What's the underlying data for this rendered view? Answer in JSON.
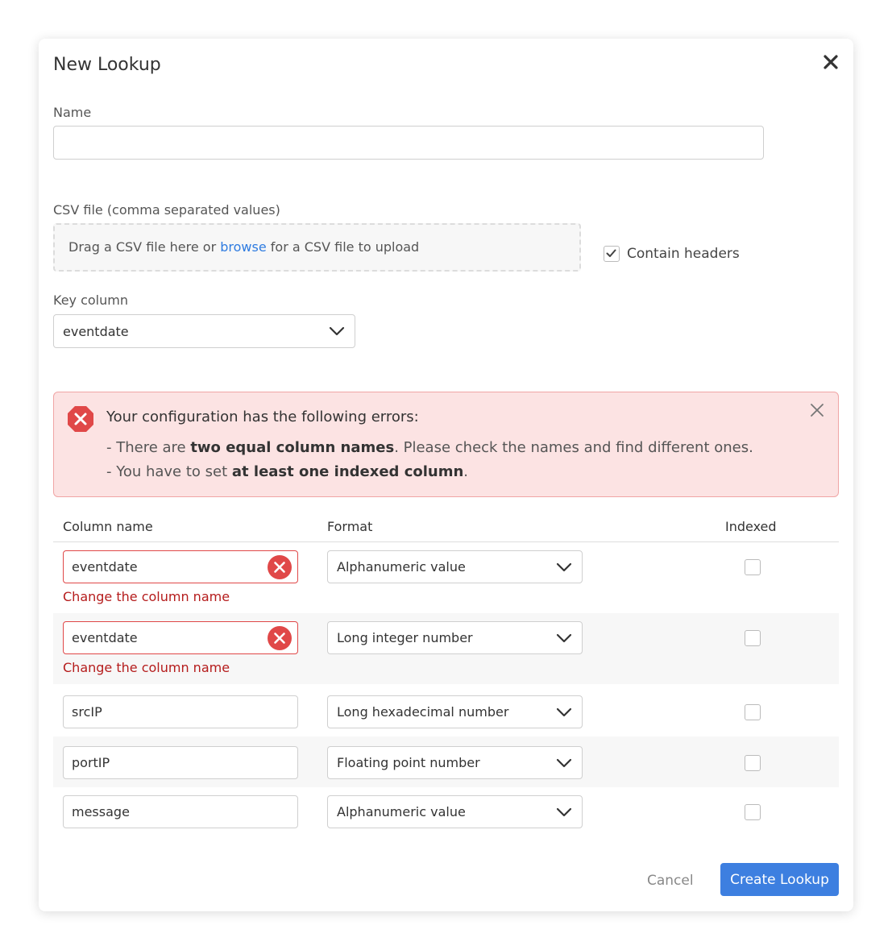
{
  "dialog": {
    "title": "New Lookup",
    "name_label": "Name",
    "name_value": "",
    "csv_label": "CSV file (comma separated values)",
    "dropzone": {
      "prefix": "Drag a CSV file here or ",
      "link": "browse",
      "suffix": " for a CSV file to upload"
    },
    "contain_headers_label": "Contain headers",
    "contain_headers_checked": true,
    "key_column_label": "Key column",
    "key_column_value": "eventdate"
  },
  "errors": {
    "title": "Your configuration has the following errors:",
    "line1": {
      "prefix": "- There are ",
      "bold": "two equal column names",
      "suffix": ". Please check the names and find different ones."
    },
    "line2": {
      "prefix": "- You have to set ",
      "bold": "at least one indexed column",
      "suffix": "."
    }
  },
  "table": {
    "headers": {
      "name": "Column name",
      "format": "Format",
      "indexed": "Indexed"
    },
    "rows": [
      {
        "name": "eventdate",
        "format": "Alphanumeric value",
        "indexed": false,
        "error": "Change the column name"
      },
      {
        "name": "eventdate",
        "format": "Long integer number",
        "indexed": false,
        "error": "Change the column name"
      },
      {
        "name": "srcIP",
        "format": "Long hexadecimal number",
        "indexed": false
      },
      {
        "name": "portIP",
        "format": "Floating point number",
        "indexed": false
      },
      {
        "name": "message",
        "format": "Alphanumeric value",
        "indexed": false
      }
    ]
  },
  "footer": {
    "cancel": "Cancel",
    "create": "Create Lookup"
  },
  "colors": {
    "accent": "#3d7fe0",
    "error": "#e04848",
    "error_bg": "#fce3e3",
    "link": "#2e7be0"
  }
}
